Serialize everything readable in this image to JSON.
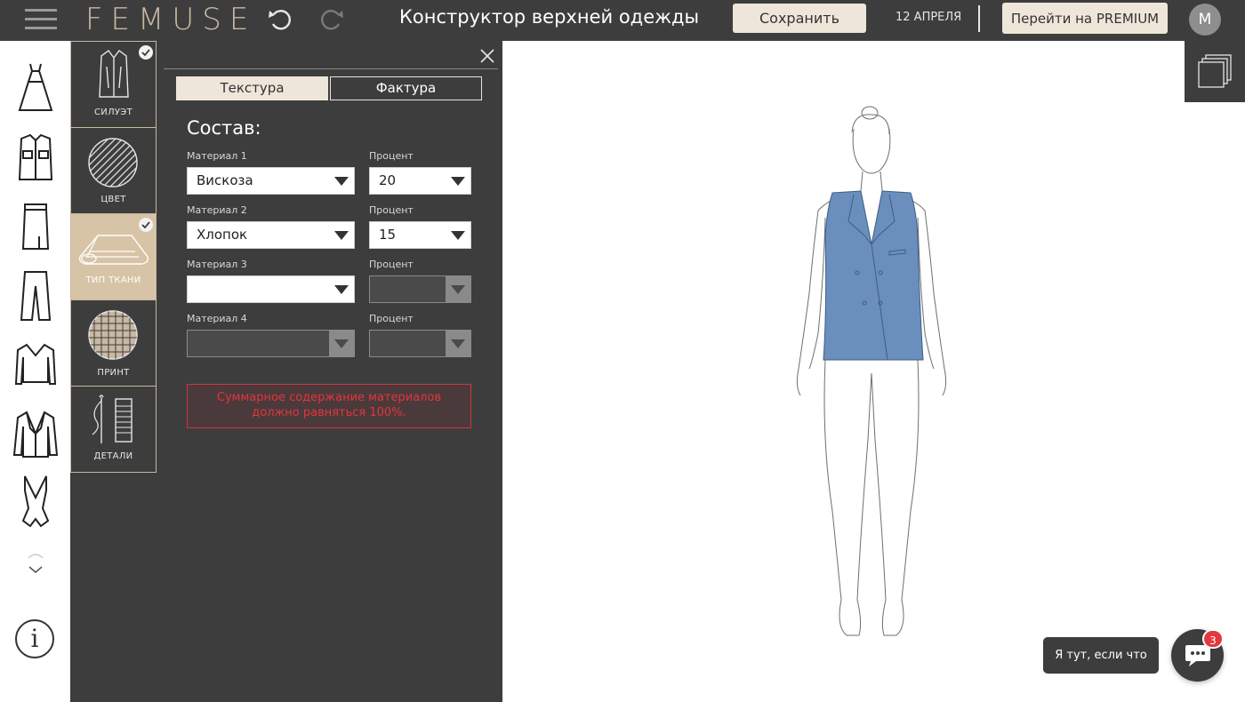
{
  "app": {
    "logo": "FEMUSE",
    "title": "Конструктор верхней одежды",
    "save_label": "Сохранить",
    "date": "12 АПРЕЛЯ",
    "premium_label": "Перейти на PREMIUM",
    "avatar_initial": "M"
  },
  "rail": {
    "items": [
      "dress-icon",
      "shirt-icon",
      "skirt-icon",
      "trousers-icon",
      "sweater-icon",
      "jacket-icon",
      "swimsuit-icon"
    ],
    "info_label": "i"
  },
  "categories": [
    {
      "label": "СИЛУЭТ",
      "icon": "coat-icon",
      "checked": true,
      "active": false
    },
    {
      "label": "ЦВЕТ",
      "icon": "color-swatch-icon",
      "checked": false,
      "active": false
    },
    {
      "label": "ТИП ТКАНИ",
      "icon": "fabric-roll-icon",
      "checked": true,
      "active": true
    },
    {
      "label": "ПРИНТ",
      "icon": "plaid-print-icon",
      "checked": false,
      "active": false
    },
    {
      "label": "ДЕТАЛИ",
      "icon": "needle-thread-icon",
      "checked": false,
      "active": false
    }
  ],
  "tabs": {
    "texture": "Текстура",
    "facture": "Фактура"
  },
  "composition": {
    "title": "Состав:",
    "rows": [
      {
        "material_label": "Материал 1",
        "material_value": "Вискоза",
        "percent_label": "Процент",
        "percent_value": "20"
      },
      {
        "material_label": "Материал 2",
        "material_value": "Хлопок",
        "percent_label": "Процент",
        "percent_value": "15"
      },
      {
        "material_label": "Материал 3",
        "material_value": "",
        "percent_label": "Процент",
        "percent_value": ""
      },
      {
        "material_label": "Материал 4",
        "material_value": "",
        "percent_label": "Процент",
        "percent_value": ""
      }
    ],
    "error_line1": "Суммарное содержание материалов",
    "error_line2": "должно равняться 100%."
  },
  "garment_color": "#6a8fbd",
  "chat": {
    "tooltip": "Я тут, если что",
    "badge": "3"
  }
}
